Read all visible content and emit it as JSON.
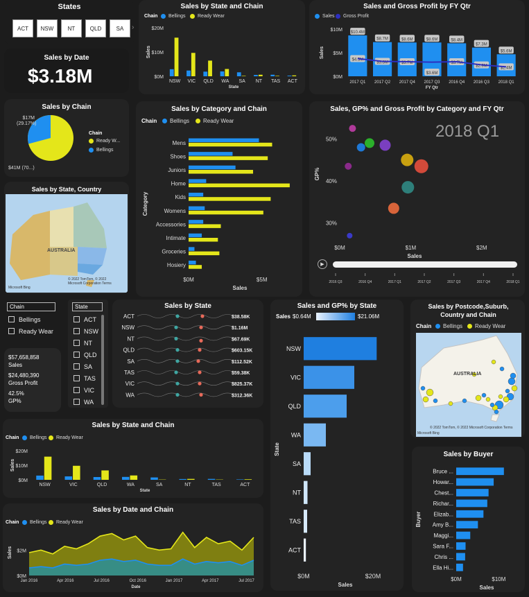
{
  "colors": {
    "bellings": "#1f8ff0",
    "ready_wear": "#e4e61a",
    "gp": "#2d2fc0",
    "teal": "#3fa6a2",
    "coral": "#e86a5a"
  },
  "states_slicer": {
    "title": "States",
    "items": [
      "ACT",
      "NSW",
      "NT",
      "QLD",
      "SA"
    ]
  },
  "sales_by_date": {
    "title": "Sales by Date",
    "value": "$3.18M"
  },
  "sales_by_chain": {
    "title": "Sales by Chain",
    "legend_title": "Chain",
    "legend": [
      "Ready W...",
      "Bellings"
    ],
    "label_top": "$17M",
    "label_top2": "(29.17%)",
    "label_bottom": "$41M (70...)"
  },
  "sales_by_state_country": {
    "title": "Sales by State, Country",
    "map_label": "AUSTRALIA",
    "attribution": "© 2022 TomTom, © 2022 Microsoft Corporation Terms",
    "brand": "Microsoft Bing"
  },
  "chain_slicer": {
    "title": "Chain",
    "items": [
      "Bellings",
      "Ready Wear"
    ]
  },
  "state_slicer": {
    "title": "State",
    "items": [
      "ACT",
      "NSW",
      "NT",
      "QLD",
      "SA",
      "TAS",
      "VIC",
      "WA"
    ]
  },
  "kpis": [
    {
      "value": "$57,658,858",
      "label": "Sales"
    },
    {
      "value": "$24,480,390",
      "label": "Gross Profit"
    },
    {
      "value": "42.5%",
      "label": "GP%"
    }
  ],
  "top_state_chain": {
    "title": "Sales by State and Chain",
    "legend_title": "Chain",
    "legend": [
      "Bellings",
      "Ready Wear"
    ],
    "yticks": [
      "$20M",
      "$10M",
      "$0M"
    ],
    "ylabel": "Sales",
    "xlabel": "State"
  },
  "fyqtr": {
    "title": "Sales and Gross Profit by FY Qtr",
    "legend": [
      "Sales",
      "Gross Profit"
    ],
    "yticks": [
      "$10M",
      "$5M",
      "$0M"
    ],
    "ylabel": "Sales",
    "xlabel": "FY Qtr"
  },
  "category_chain": {
    "title": "Sales by Category and Chain",
    "legend_title": "Chain",
    "legend": [
      "Bellings",
      "Ready Wear"
    ],
    "xticks": [
      "$0M",
      "$5M"
    ],
    "xlabel": "Sales",
    "ylabel": "Category"
  },
  "scatter": {
    "title": "Sales, GP% and Gross Profit by Category and FY Qtr",
    "watermark": "2018 Q1",
    "yticks": [
      "50%",
      "40%",
      "30%"
    ],
    "xticks": [
      "$0M",
      "$1M",
      "$2M"
    ],
    "xlabel": "Sales",
    "ylabel": "GP%",
    "play_axis": [
      "2016 Q3",
      "2016 Q4",
      "2017 Q1",
      "2017 Q2",
      "2017 Q3",
      "2017 Q4",
      "2018 Q1"
    ]
  },
  "dot_state": {
    "title": "Sales by State"
  },
  "sales_gp_state": {
    "title": "Sales and GP% by State",
    "legend_label": "Sales",
    "legend_min": "$0.64M",
    "legend_max": "$21.06M",
    "xticks": [
      "$0M",
      "$20M"
    ],
    "xlabel": "Sales",
    "ylabel": "State"
  },
  "postcode_map": {
    "title": "Sales by Postcode,Suburb, Country and Chain",
    "legend_title": "Chain",
    "legend": [
      "Bellings",
      "Ready Wear"
    ],
    "map_label": "AUSTRALIA",
    "attribution": "© 2022 TomTom, © 2022 Microsoft Corporation Terms",
    "brand": "Microsoft Bing"
  },
  "state_chain2": {
    "title": "Sales by State and Chain",
    "legend_title": "Chain",
    "legend": [
      "Bellings",
      "Ready Wear"
    ],
    "yticks": [
      "$20M",
      "$10M",
      "$0M"
    ],
    "ylabel": "Sales",
    "xlabel": "State"
  },
  "date_chain": {
    "title": "Sales by Date and Chain",
    "legend_title": "Chain",
    "legend": [
      "Bellings",
      "Ready Wear"
    ],
    "yticks": [
      "$2M",
      "$0M"
    ],
    "xticks": [
      "Jan 2016",
      "Apr 2016",
      "Jul 2016",
      "Oct 2016",
      "Jan 2017",
      "Apr 2017",
      "Jul 2017"
    ],
    "ylabel": "Sales",
    "xlabel": "Date"
  },
  "buyer": {
    "title": "Sales by Buyer",
    "xticks": [
      "$0M",
      "$10M"
    ],
    "xlabel": "Sales",
    "ylabel": "Buyer"
  },
  "chart_data": [
    {
      "type": "bar",
      "title": "Sales by State and Chain",
      "categories": [
        "NSW",
        "VIC",
        "QLD",
        "WA",
        "SA",
        "NT",
        "TAS",
        "ACT"
      ],
      "series": [
        {
          "name": "Bellings",
          "values": [
            3.2,
            2.6,
            2.1,
            2.2,
            1.8,
            0.6,
            0.7,
            0.3
          ]
        },
        {
          "name": "Ready Wear",
          "values": [
            17.5,
            10.6,
            7.1,
            3.3,
            0.2,
            0.7,
            0.2,
            0.4
          ]
        }
      ],
      "ylim": [
        0,
        22
      ]
    },
    {
      "type": "bar",
      "title": "Sales and Gross Profit by FY Qtr",
      "categories": [
        "2017 Q1",
        "2017 Q2",
        "2017 Q4",
        "2017 Q3",
        "2016 Q4",
        "2016 Q3",
        "2018 Q1"
      ],
      "series": [
        {
          "name": "Sales",
          "values": [
            10.4,
            8.7,
            8.6,
            8.6,
            8.4,
            7.3,
            5.6
          ],
          "labels": [
            "$10.4M",
            "$8.7M",
            "$8.6M",
            "$8.6M",
            "$8.4M",
            "$7.3M",
            "$5.6M"
          ]
        },
        {
          "name": "Gross Profit",
          "values": [
            4.5,
            3.8,
            3.7,
            3.6,
            3.7,
            2.9,
            2.4
          ],
          "labels": [
            "$4.5M",
            "$3.8M",
            "$3.7M",
            "$3.6M",
            "$3.7M",
            "$2.9M",
            "$2.4M"
          ]
        }
      ],
      "ylim": [
        0,
        12
      ]
    },
    {
      "type": "pie",
      "title": "Sales by Chain",
      "slices": [
        {
          "name": "Ready Wear",
          "value": 70.83
        },
        {
          "name": "Bellings",
          "value": 29.17
        }
      ]
    },
    {
      "type": "bar",
      "title": "Sales by Category and Chain",
      "categories": [
        "Mens",
        "Shoes",
        "Juniors",
        "Home",
        "Kids",
        "Womens",
        "Accessories",
        "Intimate",
        "Groceries",
        "Hosiery"
      ],
      "series": [
        {
          "name": "Bellings",
          "values": [
            4.8,
            3.0,
            3.2,
            1.2,
            1.0,
            1.1,
            1.0,
            0.9,
            0.4,
            0.5
          ]
        },
        {
          "name": "Ready Wear",
          "values": [
            5.7,
            5.4,
            4.4,
            6.9,
            5.6,
            5.1,
            2.2,
            2.0,
            2.1,
            0.9
          ]
        }
      ],
      "xlim": [
        0,
        7
      ]
    },
    {
      "type": "scatter",
      "title": "Sales, GP% and Gross Profit by Category and FY Qtr",
      "points": [
        {
          "x": 0.18,
          "y": 52.5,
          "color": "#b03a9a",
          "r": 5
        },
        {
          "x": 0.3,
          "y": 48,
          "color": "#1e78d6",
          "r": 6
        },
        {
          "x": 0.42,
          "y": 49,
          "color": "#2bb02b",
          "r": 7
        },
        {
          "x": 0.64,
          "y": 48.5,
          "color": "#7a3fc0",
          "r": 8
        },
        {
          "x": 0.12,
          "y": 43.5,
          "color": "#8a2a8a",
          "r": 5
        },
        {
          "x": 0.95,
          "y": 45,
          "color": "#c8a010",
          "r": 9
        },
        {
          "x": 1.15,
          "y": 43.5,
          "color": "#d24a3a",
          "r": 10
        },
        {
          "x": 0.96,
          "y": 38.5,
          "color": "#2e7f7a",
          "r": 9
        },
        {
          "x": 0.76,
          "y": 33.5,
          "color": "#d8643a",
          "r": 8
        },
        {
          "x": 0.14,
          "y": 27,
          "color": "#3a3ac8",
          "r": 4
        }
      ],
      "xlim": [
        0,
        2.5
      ],
      "ylim": [
        25,
        55
      ]
    },
    {
      "type": "scatter",
      "title": "Sales by State",
      "categories": [
        "ACT",
        "NSW",
        "NT",
        "QLD",
        "SA",
        "TAS",
        "VIC",
        "WA"
      ],
      "values": [
        "$38.58K",
        "$1.16M",
        "$67.69K",
        "$603.15K",
        "$112.52K",
        "$59.38K",
        "$825.37K",
        "$312.36K"
      ]
    },
    {
      "type": "bar",
      "title": "Sales and GP% by State",
      "categories": [
        "NSW",
        "VIC",
        "QLD",
        "WA",
        "SA",
        "NT",
        "TAS",
        "ACT"
      ],
      "values": [
        21.06,
        14.6,
        12.4,
        6.4,
        2.0,
        1.1,
        1.0,
        0.64
      ],
      "xlim": [
        0,
        24
      ]
    },
    {
      "type": "bar",
      "title": "Sales by State and Chain",
      "categories": [
        "NSW",
        "VIC",
        "QLD",
        "WA",
        "SA",
        "NT",
        "TAS",
        "ACT"
      ],
      "series": [
        {
          "name": "Bellings",
          "values": [
            3.2,
            2.6,
            2.1,
            2.2,
            1.8,
            0.6,
            0.7,
            0.3
          ]
        },
        {
          "name": "Ready Wear",
          "values": [
            17.5,
            10.6,
            7.1,
            3.3,
            0.2,
            0.7,
            0.2,
            0.4
          ]
        }
      ],
      "ylim": [
        0,
        22
      ]
    },
    {
      "type": "area",
      "title": "Sales by Date and Chain",
      "x": [
        "Jan 2016",
        "Feb 2016",
        "Mar 2016",
        "Apr 2016",
        "May 2016",
        "Jun 2016",
        "Jul 2016",
        "Aug 2016",
        "Sep 2016",
        "Oct 2016",
        "Nov 2016",
        "Dec 2016",
        "Jan 2017",
        "Feb 2017",
        "Mar 2017",
        "Apr 2017",
        "May 2017",
        "Jun 2017",
        "Jul 2017",
        "Aug 2017"
      ],
      "series": [
        {
          "name": "Ready Wear",
          "values": [
            1.8,
            2.0,
            1.7,
            2.3,
            2.1,
            2.5,
            3.1,
            3.3,
            2.8,
            3.1,
            2.2,
            2.0,
            2.1,
            3.4,
            2.2,
            3.0,
            2.5,
            2.7,
            2.0,
            3.0
          ]
        },
        {
          "name": "Bellings",
          "values": [
            0.6,
            0.7,
            0.6,
            0.9,
            0.8,
            0.9,
            1.2,
            1.3,
            1.1,
            1.2,
            0.9,
            0.8,
            0.8,
            1.3,
            0.9,
            1.1,
            1.0,
            1.1,
            0.8,
            1.2
          ]
        }
      ],
      "ylim": [
        0,
        3.6
      ]
    },
    {
      "type": "bar",
      "title": "Sales by Buyer",
      "categories": [
        "Bruce ...",
        "Howar...",
        "Chest...",
        "Richar...",
        "Elizab...",
        "Amy B...",
        "Maggi...",
        "Sara F...",
        "Chris ...",
        "Ella Hi..."
      ],
      "values": [
        11.2,
        8.8,
        7.6,
        7.3,
        6.4,
        5.1,
        3.3,
        2.2,
        2.1,
        1.6
      ],
      "xlim": [
        0,
        14
      ]
    }
  ]
}
